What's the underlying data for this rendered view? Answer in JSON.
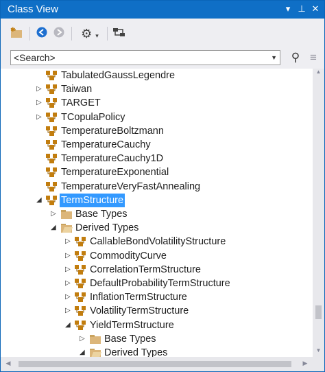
{
  "titlebar": {
    "title": "Class View",
    "dropdown_glyph": "▾",
    "pin_glyph": "⊥",
    "close_glyph": "✕"
  },
  "toolbar": {
    "new_folder_icon": "new-folder-icon",
    "back_icon": "back-icon",
    "forward_icon": "forward-icon",
    "settings_icon": "gear-icon",
    "sync_icon": "sync-icon"
  },
  "search": {
    "placeholder": "<Search>",
    "value": "<Search>"
  },
  "tree": {
    "nodes": [
      {
        "label": "TabulatedGaussLegendre",
        "expander": ""
      },
      {
        "label": "Taiwan",
        "expander": "▷"
      },
      {
        "label": "TARGET",
        "expander": "▷"
      },
      {
        "label": "TCopulaPolicy",
        "expander": "▷"
      },
      {
        "label": "TemperatureBoltzmann",
        "expander": ""
      },
      {
        "label": "TemperatureCauchy",
        "expander": ""
      },
      {
        "label": "TemperatureCauchy1D",
        "expander": ""
      },
      {
        "label": "TemperatureExponential",
        "expander": ""
      },
      {
        "label": "TemperatureVeryFastAnnealing",
        "expander": ""
      },
      {
        "label": "TermStructure",
        "expander": "◢"
      },
      {
        "label": "Base Types",
        "expander": "▷"
      },
      {
        "label": "Derived Types",
        "expander": "◢"
      },
      {
        "label": "CallableBondVolatilityStructure",
        "expander": "▷"
      },
      {
        "label": "CommodityCurve",
        "expander": "▷"
      },
      {
        "label": "CorrelationTermStructure",
        "expander": "▷"
      },
      {
        "label": "DefaultProbabilityTermStructure",
        "expander": "▷"
      },
      {
        "label": "InflationTermStructure",
        "expander": "▷"
      },
      {
        "label": "VolatilityTermStructure",
        "expander": "▷"
      },
      {
        "label": "YieldTermStructure",
        "expander": "◢"
      },
      {
        "label": "Base Types",
        "expander": "▷"
      },
      {
        "label": "Derived Types",
        "expander": "◢"
      }
    ]
  },
  "colors": {
    "accent": "#0f6fc6",
    "selection": "#3399ff",
    "class_icon": "#c27d0e",
    "folder": "#dcb67a"
  }
}
